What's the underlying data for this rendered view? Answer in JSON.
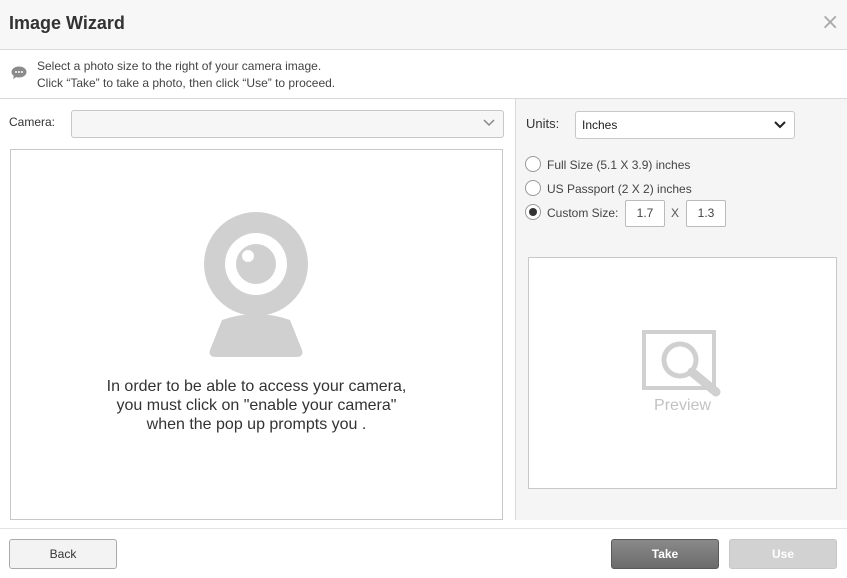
{
  "dialog": {
    "title": "Image Wizard",
    "close_glyph": "×"
  },
  "instructions": {
    "icon": "speech-bubble-icon",
    "line1": "Select a photo size to the right of your camera image.",
    "line2": "Click “Take” to take a photo, then click “Use” to proceed."
  },
  "camera": {
    "label": "Camera:",
    "selected": "",
    "message_line1": "In order to be able to access your camera,",
    "message_line2": "you must click on \"enable your camera\"",
    "message_line3": "when the pop up prompts you ."
  },
  "units": {
    "label": "Units:",
    "selected": "Inches"
  },
  "sizes": {
    "full_size": "Full Size (5.1 X 3.9) inches",
    "passport": "US Passport (2 X 2) inches",
    "custom": "Custom Size:",
    "selected": "custom",
    "custom_width": "1.7",
    "times": "X",
    "custom_height": "1.3"
  },
  "preview": {
    "label": "Preview"
  },
  "footer": {
    "back_label": "Back",
    "take_label": "Take",
    "use_label": "Use"
  },
  "colors": {
    "take_button": "#7a7a7a",
    "use_button_disabled": "#d2d2d2",
    "icon_gray": "#d0d0d0"
  }
}
